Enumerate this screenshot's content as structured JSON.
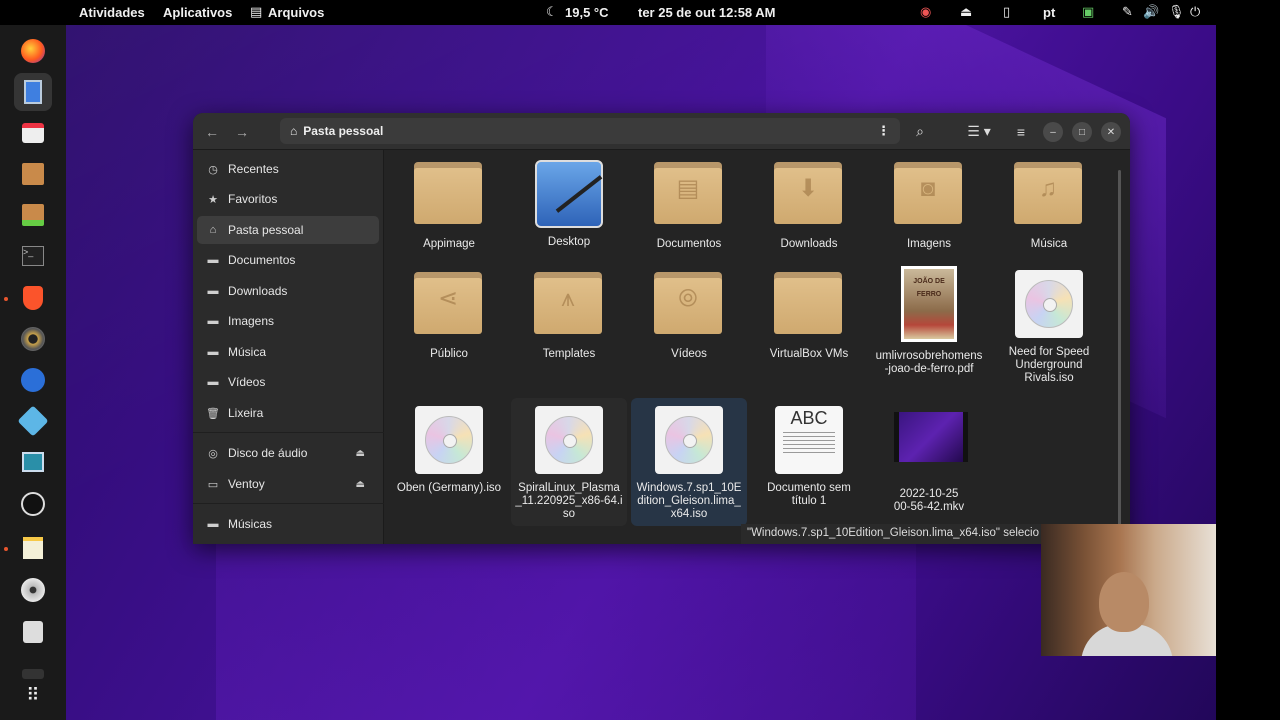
{
  "topbar": {
    "activities": "Atividades",
    "applications": "Aplicativos",
    "files_app": "Arquivos",
    "weather": "19,5 °C",
    "datetime": "ter 25 de out  12:58 AM",
    "keyboard_layout": "pt"
  },
  "dock": {
    "items": [
      "firefox-icon",
      "files-icon",
      "software-store-icon",
      "archive-manager-icon",
      "software-install-icon",
      "terminal-icon",
      "brave-icon",
      "audio-icon",
      "equalizer-icon",
      "game-icon",
      "system-monitor-icon",
      "obs-icon",
      "text-editor-icon",
      "disc-icon",
      "usb-icon",
      "disk-icon",
      "app-grid-icon"
    ]
  },
  "window": {
    "path": "Pasta pessoal"
  },
  "sidebar": {
    "items": [
      {
        "label": "Recentes",
        "icon": "clock-icon"
      },
      {
        "label": "Favoritos",
        "icon": "star-icon"
      },
      {
        "label": "Pasta pessoal",
        "icon": "home-icon"
      },
      {
        "label": "Documentos",
        "icon": "folder-icon"
      },
      {
        "label": "Downloads",
        "icon": "folder-icon"
      },
      {
        "label": "Imagens",
        "icon": "folder-icon"
      },
      {
        "label": "Música",
        "icon": "folder-icon"
      },
      {
        "label": "Vídeos",
        "icon": "folder-icon"
      },
      {
        "label": "Lixeira",
        "icon": "trash-icon"
      }
    ],
    "devices": [
      {
        "label": "Disco de áudio",
        "icon": "cd-icon"
      },
      {
        "label": "Ventoy",
        "icon": "drive-icon"
      }
    ],
    "bookmarks": [
      {
        "label": "Músicas",
        "icon": "folder-icon"
      }
    ]
  },
  "files": [
    {
      "name": "Appimage",
      "type": "folder"
    },
    {
      "name": "Desktop",
      "type": "desktop"
    },
    {
      "name": "Documentos",
      "type": "folder",
      "emblem": "document"
    },
    {
      "name": "Downloads",
      "type": "folder",
      "emblem": "download"
    },
    {
      "name": "Imagens",
      "type": "folder",
      "emblem": "camera"
    },
    {
      "name": "Música",
      "type": "folder",
      "emblem": "music"
    },
    {
      "name": "Público",
      "type": "folder",
      "emblem": "share"
    },
    {
      "name": "Templates",
      "type": "folder",
      "emblem": "compass"
    },
    {
      "name": "Vídeos",
      "type": "folder",
      "emblem": "film"
    },
    {
      "name": "VirtualBox VMs",
      "type": "folder"
    },
    {
      "name": "umlivrosobrehomens-joao-de-ferro.pdf",
      "type": "pdf",
      "cover_text": "JOÃO DE FERRO"
    },
    {
      "name": "Need for Speed Underground Rivals.iso",
      "type": "iso"
    },
    {
      "name": "Oben (Germany).iso",
      "type": "iso"
    },
    {
      "name": "SpiralLinux_Plasma_11.220925_x86-64.iso",
      "type": "iso"
    },
    {
      "name": "Windows.7.sp1_10Edition_Gleison.lima_x64.iso",
      "type": "iso",
      "selected": true
    },
    {
      "name": "Documento sem título 1",
      "type": "document",
      "preview": "ABC"
    },
    {
      "name": "2022-10-25 00-56-42.mkv",
      "type": "video"
    }
  ],
  "statusbar": {
    "text": "\"Windows.7.sp1_10Edition_Gleison.lima_x64.iso\" selecio"
  }
}
